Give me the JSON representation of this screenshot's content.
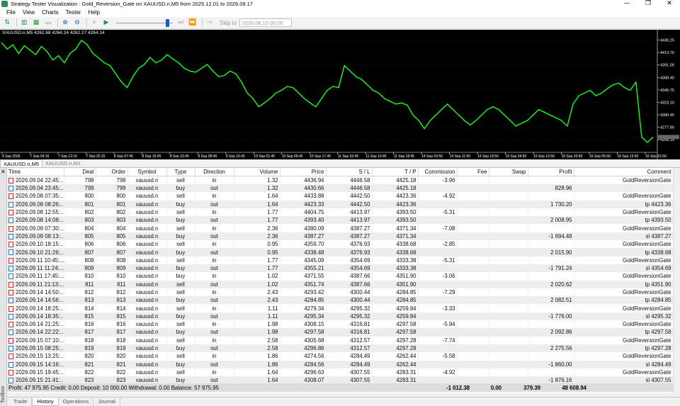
{
  "window": {
    "title": "Strategy Tester Visualization : Gold_Reversion_Gate on XAUUSD.n,M5 from 2025.12.01 to 2026.09.17",
    "min_glyph": "—",
    "max_glyph": "❐",
    "close_glyph": "✕"
  },
  "menu": [
    "File",
    "View",
    "Charts",
    "Tester",
    "Help"
  ],
  "toolbar": {
    "skip_label": "Skip to",
    "skip_date": "2026.08.15 00:00"
  },
  "chart": {
    "info": "XAUUSD.n,M5  4262.68 4264.24 4262.27 4264.14",
    "line_color": "#22dd22",
    "grid_color": "#3a3a3a"
  },
  "chart_data": {
    "type": "line",
    "title": "XAUUSD.n,M5",
    "ylim": [
      4236,
      4450
    ],
    "y_ticks": [
      "4436.25",
      "4413.70",
      "4391.05",
      "4368.40",
      "4345.75",
      "4323.10",
      "4300.45",
      "4277.80",
      "4255.15"
    ],
    "x_ticks": [
      "4 Sep 2026",
      "7 Sep 04:15",
      "7 Sep 12:15",
      "7 Sep 20:15",
      "8 Sep 07:45",
      "8 Sep 15:45",
      "8 Sep 23:45",
      "9 Sep 08:45",
      "9 Sep 16:45",
      "10 Sep 01:45",
      "10 Sep 09:45",
      "10 Sep 17:45",
      "11 Sep 02:45",
      "11 Sep 10:45",
      "11 Sep 18:45",
      "14 Sep 03:50",
      "14 Sep 11:50",
      "14 Sep 19:50",
      "15 Sep 04:50",
      "15 Sep 12:50",
      "15 Sep 20:50",
      "16 Sep 05:50",
      "16 Sep 13:50",
      "16 Sep 21:50"
    ],
    "series": [
      {
        "name": "XAUUSD.n",
        "values": [
          4432,
          4420,
          4428,
          4412,
          4426,
          4418,
          4410,
          4425,
          4415,
          4400,
          4408,
          4395,
          4412,
          4420,
          4436,
          4428,
          4412,
          4404,
          4395,
          4390,
          4375,
          4360,
          4350,
          4370,
          4385,
          4392,
          4405,
          4395,
          4400,
          4410,
          4402,
          4395,
          4385,
          4380,
          4378,
          4385,
          4392,
          4380,
          4370,
          4372,
          4380,
          4375,
          4360,
          4340,
          4330,
          4315,
          4322,
          4330,
          4340,
          4345,
          4352,
          4350,
          4340,
          4330,
          4322,
          4315,
          4330,
          4345,
          4352,
          4350,
          4390,
          4380,
          4370,
          4365,
          4355,
          4345,
          4340,
          4330,
          4325,
          4320,
          4322,
          4318,
          4300,
          4290,
          4275,
          4290,
          4300,
          4310,
          4320,
          4310,
          4300,
          4290,
          4282,
          4290,
          4300,
          4310,
          4315,
          4310,
          4300,
          4290,
          4280,
          4285,
          4290,
          4300,
          4310,
          4305,
          4300,
          4295,
          4290,
          4280,
          4320,
          4335,
          4340,
          4345,
          4335,
          4340,
          4348,
          4355,
          4358,
          4350,
          4345,
          4360,
          4260,
          4250,
          4260
        ]
      }
    ]
  },
  "chart_tabs": [
    "XAUUSD.n,M5",
    "XAUUSD.n,M1"
  ],
  "table": {
    "columns": [
      "Time",
      "Deal",
      "Order",
      "Symbol",
      "Type",
      "Direction",
      "Volume",
      "Price",
      "S / L",
      "T / P",
      "Commission",
      "Fee",
      "Swap",
      "Profit",
      "Comment"
    ],
    "rows": [
      [
        "2026.09.04 22:45:...",
        "798",
        "798",
        "xauusd.n",
        "sell",
        "in",
        "1.32",
        "4436.94",
        "4446.58",
        "4425.18",
        "-3.96",
        "",
        "",
        "",
        "GoldReversionGate"
      ],
      [
        "2026.09.04 23:45:...",
        "799",
        "799",
        "xauusd.n",
        "buy",
        "out",
        "1.32",
        "4430.66",
        "4446.58",
        "4425.18",
        "",
        "",
        "",
        "828.96",
        ""
      ],
      [
        "2026.09.08 07:35:...",
        "800",
        "800",
        "xauusd.n",
        "sell",
        "in",
        "1.64",
        "4433.88",
        "4442.50",
        "4423.36",
        "-4.92",
        "",
        "",
        "",
        "GoldReversionGate"
      ],
      [
        "2026.09.08 08:26:...",
        "801",
        "801",
        "xauusd.n",
        "buy",
        "out",
        "1.64",
        "4423.33",
        "4442.50",
        "4423.36",
        "",
        "",
        "",
        "1 730.20",
        "tp 4423.36"
      ],
      [
        "2026.09.08 12:55:...",
        "802",
        "802",
        "xauusd.n",
        "sell",
        "in",
        "1.77",
        "4404.75",
        "4413.97",
        "4393.50",
        "-5.31",
        "",
        "",
        "",
        "GoldReversionGate"
      ],
      [
        "2026.09.08 14:08:...",
        "803",
        "803",
        "xauusd.n",
        "buy",
        "out",
        "1.77",
        "4393.40",
        "4413.97",
        "4393.50",
        "",
        "",
        "",
        "2 008.95",
        "tp 4393.50"
      ],
      [
        "2026.09.09 07:30:...",
        "804",
        "804",
        "xauusd.n",
        "sell",
        "in",
        "2.36",
        "4380.09",
        "4387.27",
        "4371.34",
        "-7.08",
        "",
        "",
        "",
        "GoldReversionGate"
      ],
      [
        "2026.09.09 08:13:...",
        "805",
        "805",
        "xauusd.n",
        "buy",
        "out",
        "2.36",
        "4387.27",
        "4387.27",
        "4371.34",
        "",
        "",
        "",
        "-1 694.48",
        "sl 4387.27"
      ],
      [
        "2026.09.10 18:15:...",
        "806",
        "806",
        "xauusd.n",
        "sell",
        "in",
        "0.95",
        "4359.70",
        "4376.93",
        "4338.68",
        "-2.85",
        "",
        "",
        "",
        "GoldReversionGate"
      ],
      [
        "2026.09.10 21:26:...",
        "807",
        "807",
        "xauusd.n",
        "buy",
        "out",
        "0.95",
        "4338.48",
        "4376.93",
        "4338.68",
        "",
        "",
        "",
        "2 015.90",
        "tp 4338.68"
      ],
      [
        "2026.09.11 10:45:...",
        "808",
        "808",
        "xauusd.n",
        "sell",
        "in",
        "1.77",
        "4345.09",
        "4354.69",
        "4333.38",
        "-5.31",
        "",
        "",
        "",
        "GoldReversionGate"
      ],
      [
        "2026.09.11 11:24:...",
        "809",
        "809",
        "xauusd.n",
        "buy",
        "out",
        "1.77",
        "4355.21",
        "4354.69",
        "4333.38",
        "",
        "",
        "",
        "-1 791.24",
        "sl 4354.69"
      ],
      [
        "2026.09.11 17:45:...",
        "810",
        "810",
        "xauusd.n",
        "buy",
        "in",
        "1.02",
        "4371.55",
        "4387.66",
        "4351.90",
        "-3.06",
        "",
        "",
        "",
        "GoldReversionGate"
      ],
      [
        "2026.09.11 21:13:...",
        "811",
        "811",
        "xauusd.n",
        "sell",
        "out",
        "1.02",
        "4351.74",
        "4387.66",
        "4351.90",
        "",
        "",
        "",
        "2 020.62",
        "tp 4351.90"
      ],
      [
        "2026.09.14 14:50:...",
        "812",
        "812",
        "xauusd.n",
        "sell",
        "in",
        "2.43",
        "4293.42",
        "4300.44",
        "4284.85",
        "-7.29",
        "",
        "",
        "",
        "GoldReversionGate"
      ],
      [
        "2026.09.14 14:56:...",
        "813",
        "813",
        "xauusd.n",
        "buy",
        "out",
        "2.43",
        "4284.85",
        "4300.44",
        "4284.85",
        "",
        "",
        "",
        "2 082.51",
        "tp 4284.85"
      ],
      [
        "2026.09.14 18:25:...",
        "814",
        "814",
        "xauusd.n",
        "sell",
        "in",
        "1.11",
        "4279.34",
        "4295.32",
        "4259.84",
        "-3.33",
        "",
        "",
        "",
        "GoldReversionGate"
      ],
      [
        "2026.09.14 18:35:...",
        "815",
        "815",
        "xauusd.n",
        "buy",
        "out",
        "1.11",
        "4295.34",
        "4295.32",
        "4259.84",
        "",
        "",
        "",
        "-1 776.00",
        "sl 4295.32"
      ],
      [
        "2026.09.14 21:25:...",
        "816",
        "816",
        "xauusd.n",
        "sell",
        "in",
        "1.98",
        "4308.15",
        "4316.81",
        "4297.58",
        "-5.94",
        "",
        "",
        "",
        "GoldReversionGate"
      ],
      [
        "2026.09.14 22:22:...",
        "817",
        "817",
        "xauusd.n",
        "buy",
        "out",
        "1.98",
        "4297.58",
        "4316.81",
        "4297.58",
        "",
        "",
        "",
        "2 092.86",
        "tp 4297.58"
      ],
      [
        "2026.09.15 07:10:...",
        "818",
        "818",
        "xauusd.n",
        "sell",
        "in",
        "2.58",
        "4305.68",
        "4312.57",
        "4297.28",
        "-7.74",
        "",
        "",
        "",
        "GoldReversionGate"
      ],
      [
        "2026.09.15 08:25:...",
        "819",
        "819",
        "xauusd.n",
        "buy",
        "out",
        "2.58",
        "4296.86",
        "4312.57",
        "4297.28",
        "",
        "",
        "",
        "2 275.56",
        "tp 4297.28"
      ],
      [
        "2026.09.15 13:25:...",
        "820",
        "820",
        "xauusd.n",
        "sell",
        "in",
        "1.86",
        "4274.56",
        "4284.49",
        "4262.44",
        "-5.58",
        "",
        "",
        "",
        "GoldReversionGate"
      ],
      [
        "2026.09.15 14:16:...",
        "821",
        "821",
        "xauusd.n",
        "buy",
        "out",
        "1.86",
        "4284.56",
        "4284.49",
        "4262.44",
        "",
        "",
        "",
        "-1 860.00",
        "sl 4284.49"
      ],
      [
        "2026.09.15 19:45:...",
        "822",
        "822",
        "xauusd.n",
        "sell",
        "in",
        "1.64",
        "4296.63",
        "4307.55",
        "4283.31",
        "-4.92",
        "",
        "",
        "",
        "GoldReversionGate"
      ],
      [
        "2026.09.15 21:41:...",
        "823",
        "823",
        "xauusd.n",
        "buy",
        "out",
        "1.64",
        "4308.07",
        "4307.55",
        "4283.31",
        "",
        "",
        "",
        "-1 876.16",
        "sl 4307.55"
      ]
    ]
  },
  "summary": {
    "text": "Profit: 47 975.95  Credit: 0.00  Deposit: 10 000.00  Withdrawal: 0.00  Balance: 57 975.95",
    "commission": "-1 012.38",
    "fee": "0.00",
    "swap": "379.39",
    "profit": "48 608.94"
  },
  "bottom_tabs": [
    "Trade",
    "History",
    "Operations",
    "Journal"
  ],
  "sidebar_label": "Toolbox"
}
